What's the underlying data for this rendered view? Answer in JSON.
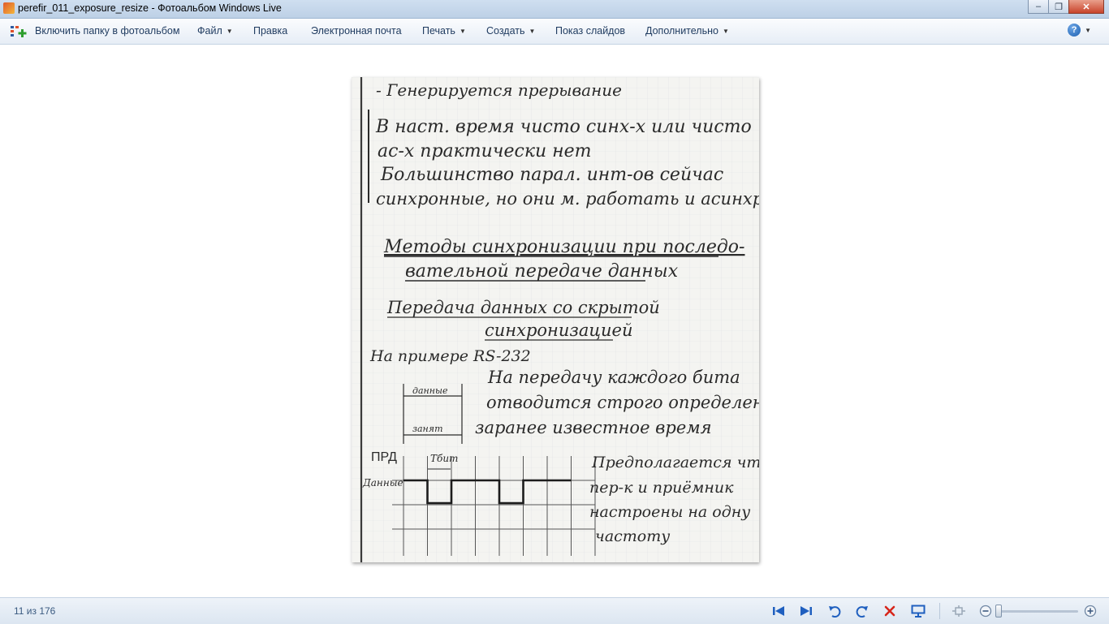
{
  "window": {
    "title": "perefir_011_exposure_resize - Фотоальбом Windows Live",
    "controls": {
      "minimize": "‒",
      "maximize": "❐",
      "close": "✕"
    }
  },
  "menubar": {
    "include_folder": "Включить папку в фотоальбом",
    "items": [
      {
        "label": "Файл",
        "dropdown": true
      },
      {
        "label": "Правка",
        "dropdown": false
      },
      {
        "label": "Электронная почта",
        "dropdown": false
      },
      {
        "label": "Печать",
        "dropdown": true
      },
      {
        "label": "Создать",
        "dropdown": true
      },
      {
        "label": "Показ слайдов",
        "dropdown": false
      },
      {
        "label": "Дополнительно",
        "dropdown": true
      }
    ],
    "help": "?"
  },
  "photo": {
    "notes": {
      "line1": "- Генерируется прерывание",
      "line2": "В наст. время чисто синх-х или чисто",
      "line3": "ас-х практически нет",
      "line4": "Большинство парал. инт-ов сейчас",
      "line5": "синхронные, но они м. работать и асинхр-о",
      "heading1a": "Методы синхронизации при последо-",
      "heading1b": "вательной передаче данных",
      "heading2a": "Передача данных со скрытой",
      "heading2b": "синхронизацией",
      "example": "На примере RS-232",
      "diagram_data": "данные",
      "diagram_busy": "занят",
      "para1a": "На передачу каждого бита",
      "para1b": "отводится строго определенное",
      "para1c": "заранее известное время",
      "prd": "ПРД",
      "tbit": "Tбит",
      "signal": "Данные",
      "para2a": "Предполагается что",
      "para2b": "пер-к и приёмник",
      "para2c": "настроены на одну",
      "para2d": "частоту"
    },
    "signal_levels": [
      1,
      0,
      1,
      1,
      0,
      1,
      1
    ]
  },
  "statusbar": {
    "counter": "11 из 176",
    "icons": [
      "previous-icon",
      "next-icon",
      "rotate-left-icon",
      "rotate-right-icon",
      "delete-icon",
      "slideshow-icon",
      "fit-icon",
      "zoom-out-icon",
      "zoom-in-icon"
    ],
    "zoom_level": 0
  },
  "colors": {
    "accent": "#1e3a5f",
    "titlebar": "#c9dbef",
    "paper": "#f4f4f1",
    "ink": "#2a2a2a",
    "grid": "#c8ccd2",
    "delete_red": "#d7261b",
    "nav_blue": "#1f5fbf"
  }
}
